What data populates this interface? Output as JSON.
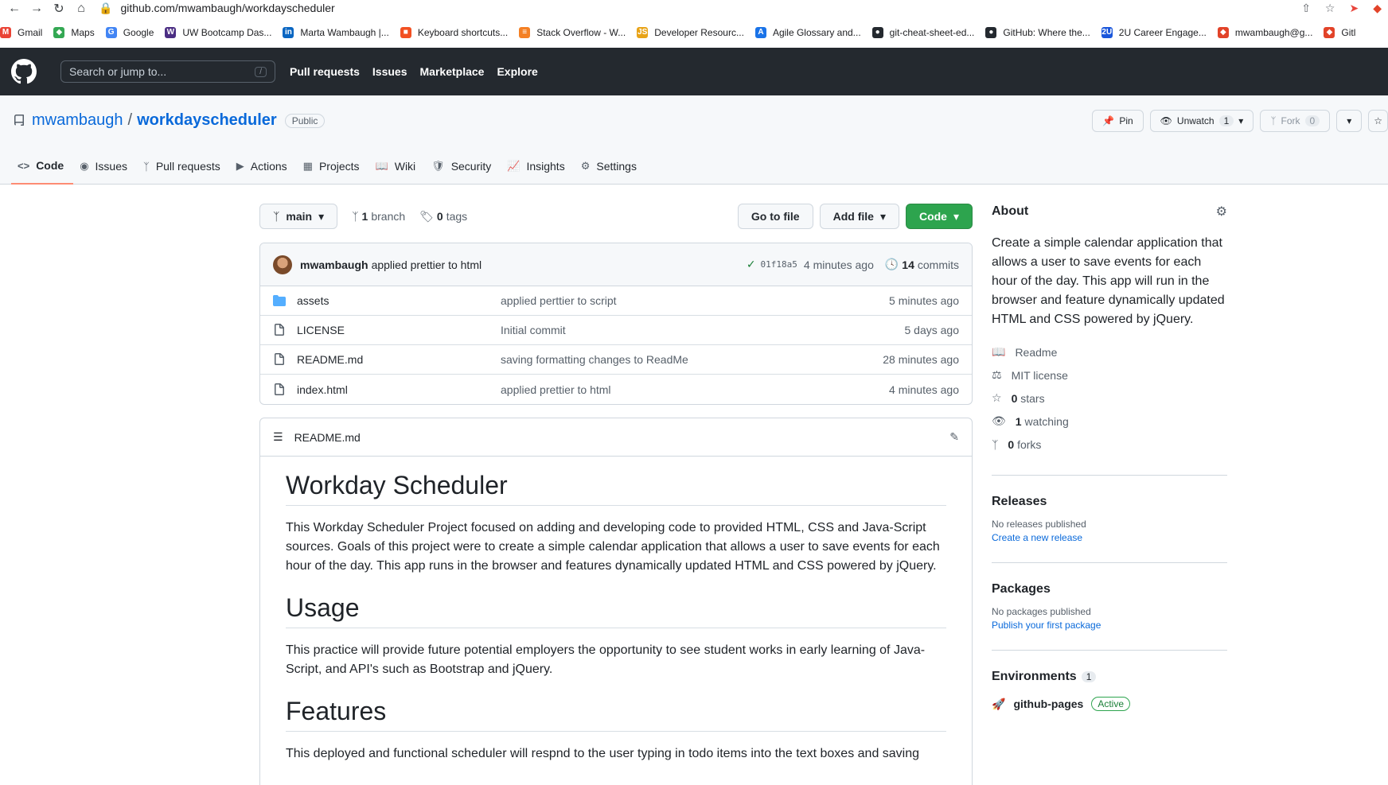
{
  "browser": {
    "url": "github.com/mwambaugh/workdayscheduler",
    "bookmarks": [
      {
        "label": "Gmail",
        "color": "#ea4335",
        "glyph": "M"
      },
      {
        "label": "Maps",
        "color": "#34a853",
        "glyph": "◆"
      },
      {
        "label": "Google",
        "color": "#4285f4",
        "glyph": "G"
      },
      {
        "label": "UW Bootcamp Das...",
        "color": "#4b2e83",
        "glyph": "W"
      },
      {
        "label": "Marta Wambaugh |...",
        "color": "#0a66c2",
        "glyph": "in"
      },
      {
        "label": "Keyboard shortcuts...",
        "color": "#f25022",
        "glyph": "■"
      },
      {
        "label": "Stack Overflow - W...",
        "color": "#f48024",
        "glyph": "≡"
      },
      {
        "label": "Developer Resourc...",
        "color": "#e8a317",
        "glyph": "JS"
      },
      {
        "label": "Agile Glossary and...",
        "color": "#1a73e8",
        "glyph": "A"
      },
      {
        "label": "git-cheat-sheet-ed...",
        "color": "#24292f",
        "glyph": "●"
      },
      {
        "label": "GitHub: Where the...",
        "color": "#24292f",
        "glyph": "●"
      },
      {
        "label": "2U Career Engage...",
        "color": "#1a56db",
        "glyph": "2U"
      },
      {
        "label": "mwambaugh@g...",
        "color": "#e24329",
        "glyph": "◆"
      },
      {
        "label": "Gitl",
        "color": "#e24329",
        "glyph": "◆"
      }
    ]
  },
  "header": {
    "search_placeholder": "Search or jump to...",
    "search_key": "/",
    "nav": [
      "Pull requests",
      "Issues",
      "Marketplace",
      "Explore"
    ]
  },
  "repo": {
    "owner": "mwambaugh",
    "name": "workdayscheduler",
    "visibility": "Public",
    "pin": "Pin",
    "unwatch": "Unwatch",
    "watch_count": "1",
    "fork": "Fork",
    "fork_count": "0",
    "tabs": [
      "Code",
      "Issues",
      "Pull requests",
      "Actions",
      "Projects",
      "Wiki",
      "Security",
      "Insights",
      "Settings"
    ]
  },
  "file_nav": {
    "branch": "main",
    "branches_count": "1",
    "branches_label": "branch",
    "tags_count": "0",
    "tags_label": "tags",
    "go_to_file": "Go to file",
    "add_file": "Add file",
    "code": "Code"
  },
  "commit": {
    "author": "mwambaugh",
    "message": "applied prettier to html",
    "sha": "01f18a5",
    "time": "4 minutes ago",
    "count": "14",
    "count_label": "commits"
  },
  "files": [
    {
      "type": "dir",
      "name": "assets",
      "message": "applied perttier to script",
      "age": "5 minutes ago"
    },
    {
      "type": "file",
      "name": "LICENSE",
      "message": "Initial commit",
      "age": "5 days ago"
    },
    {
      "type": "file",
      "name": "README.md",
      "message": "saving formatting changes to ReadMe",
      "age": "28 minutes ago"
    },
    {
      "type": "file",
      "name": "index.html",
      "message": "applied prettier to html",
      "age": "4 minutes ago"
    }
  ],
  "readme": {
    "filename": "README.md",
    "title": "Workday Scheduler",
    "intro": "This Workday Scheduler Project focused on adding and developing code to provided HTML, CSS and Java-Script sources. Goals of this project were to create a simple calendar application that allows a user to save events for each hour of the day. This app runs in the browser and features dynamically updated HTML and CSS powered by jQuery.",
    "usage_heading": "Usage",
    "usage_text": "This practice will provide future potential employers the opportunity to see student works in early learning of Java-Script, and API's such as Bootstrap and jQuery.",
    "features_heading": "Features",
    "features_text": "This deployed and functional scheduler will respnd to the user typing in todo items into the text boxes and saving"
  },
  "about": {
    "heading": "About",
    "description": "Create a simple calendar application that allows a user to save events for each hour of the day. This app will run in the browser and feature dynamically updated HTML and CSS powered by jQuery.",
    "readme": "Readme",
    "license": "MIT license",
    "stars_count": "0",
    "stars_label": "stars",
    "watching_count": "1",
    "watching_label": "watching",
    "forks_count": "0",
    "forks_label": "forks"
  },
  "releases": {
    "heading": "Releases",
    "none": "No releases published",
    "link": "Create a new release"
  },
  "packages": {
    "heading": "Packages",
    "none": "No packages published",
    "link": "Publish your first package"
  },
  "environments": {
    "heading": "Environments",
    "count": "1",
    "name": "github-pages",
    "status": "Active"
  }
}
